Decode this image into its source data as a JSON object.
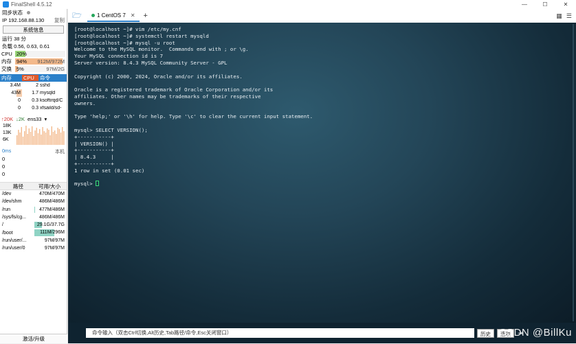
{
  "window": {
    "title": "FinalShell 4.5.12",
    "controls": [
      "—",
      "☐",
      "✕"
    ]
  },
  "sidebar": {
    "sync_label": "同步状态",
    "ip_label": "IP",
    "ip_value": "192.168.88.130",
    "copy_label": "复制",
    "sysinfo_button": "系统信息",
    "uptime": "运行 38 分",
    "load": "负载 0.56, 0.63, 0.61",
    "meters": [
      {
        "label": "CPU",
        "pct": "20%",
        "amount": "",
        "fill": 0.2,
        "color": "#9ad67a"
      },
      {
        "label": "内存",
        "pct": "94%",
        "amount": "912M/972M",
        "fill": 0.94,
        "color": "#f3b98b"
      },
      {
        "label": "交换",
        "pct": "5%",
        "amount": "97M/2G",
        "fill": 0.05,
        "color": "#f3b98b"
      }
    ],
    "process_headers": [
      "内存",
      "CPU",
      "命令"
    ],
    "processes": [
      {
        "mem": "3.4M",
        "cpu": "2",
        "cmd": "sshd"
      },
      {
        "mem": "43M",
        "cpu": "1.7",
        "cmd": "mysqld"
      },
      {
        "mem": "0",
        "cpu": "0.3",
        "cmd": "ksoftirqd/C"
      },
      {
        "mem": "0",
        "cpu": "0.3",
        "cmd": "xfsaild/sd-"
      }
    ],
    "net": {
      "up": "↑20K",
      "down": "↓2K",
      "iface": "ens33",
      "scale": [
        "18K",
        "13K",
        "6K"
      ]
    },
    "latency": {
      "head": "0ms",
      "local": "本机",
      "values": [
        "0",
        "0",
        "0"
      ]
    },
    "disk_headers": [
      "路径",
      "可用/大小"
    ],
    "disks": [
      {
        "path": "/dev",
        "size": "470M/470M",
        "used": 0.0
      },
      {
        "path": "/dev/shm",
        "size": "486M/486M",
        "used": 0.0
      },
      {
        "path": "/run",
        "size": "477M/486M",
        "used": 0.02
      },
      {
        "path": "/sys/fs/cg...",
        "size": "486M/486M",
        "used": 0.0
      },
      {
        "path": "/",
        "size": "29.1G/37.7G",
        "used": 0.23
      },
      {
        "path": "/boot",
        "size": "111M/296M",
        "used": 0.62
      },
      {
        "path": "/run/user/...",
        "size": "97M/97M",
        "used": 0.0
      },
      {
        "path": "/run/user/0",
        "size": "97M/97M",
        "used": 0.0
      }
    ],
    "upgrade": "激活/升级"
  },
  "tabs": {
    "active_label": "1 CentOS 7",
    "plus": "+"
  },
  "terminal": {
    "lines": [
      "[root@localhost ~]# vim /etc/my.cnf",
      "[root@localhost ~]# systemctl restart mysqld",
      "[root@localhost ~]# mysql -u root",
      "Welcome to the MySQL monitor.  Commands end with ; or \\g.",
      "Your MySQL connection id is 7",
      "Server version: 8.4.3 MySQL Community Server - GPL",
      "",
      "Copyright (c) 2000, 2024, Oracle and/or its affiliates.",
      "",
      "Oracle is a registered trademark of Oracle Corporation and/or its",
      "affiliates. Other names may be trademarks of their respective",
      "owners.",
      "",
      "Type 'help;' or '\\h' for help. Type '\\c' to clear the current input statement.",
      "",
      "mysql> SELECT VERSION();",
      "+-----------+",
      "| VERSION() |",
      "+-----------+",
      "| 8.4.3     |",
      "+-----------+",
      "1 row in set (0.01 sec)",
      ""
    ],
    "prompt": "mysql> "
  },
  "cmdbar": {
    "placeholder": "命令输入（双击Ctrl切换,Alt历史,Tab路径/命令,Esc关闭窗口）",
    "history": "历史",
    "options": "选项",
    "watermark": "CSDN @BillKu"
  }
}
